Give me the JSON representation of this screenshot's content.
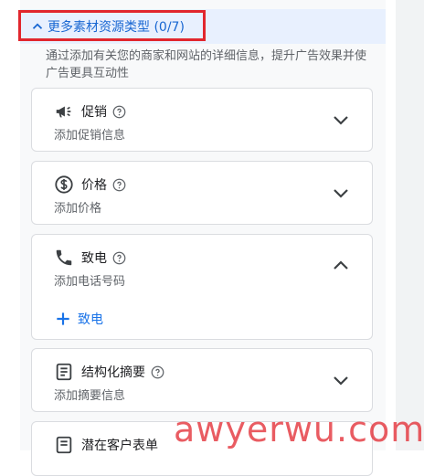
{
  "section": {
    "title": "更多素材资源类型 (0/7)",
    "description": "通过添加有关您的商家和网站的详细信息，提升广告效果并使广告更具互动性"
  },
  "cards": [
    {
      "title": "促销",
      "subtitle": "添加促销信息",
      "icon": "megaphone-icon",
      "expanded": false
    },
    {
      "title": "价格",
      "subtitle": "添加价格",
      "icon": "dollar-circle-icon",
      "expanded": false
    },
    {
      "title": "致电",
      "subtitle": "添加电话号码",
      "icon": "phone-icon",
      "expanded": true,
      "add_label": "致电"
    },
    {
      "title": "结构化摘要",
      "subtitle": "添加摘要信息",
      "icon": "document-icon",
      "expanded": false
    },
    {
      "title": "潜在客户表单",
      "subtitle": "",
      "icon": "form-icon",
      "expanded": false
    }
  ],
  "watermark": "awyerwu.com",
  "colors": {
    "accent": "#1a73e8",
    "header_bg": "#e8f0fe",
    "highlight_box": "#e1262d"
  }
}
